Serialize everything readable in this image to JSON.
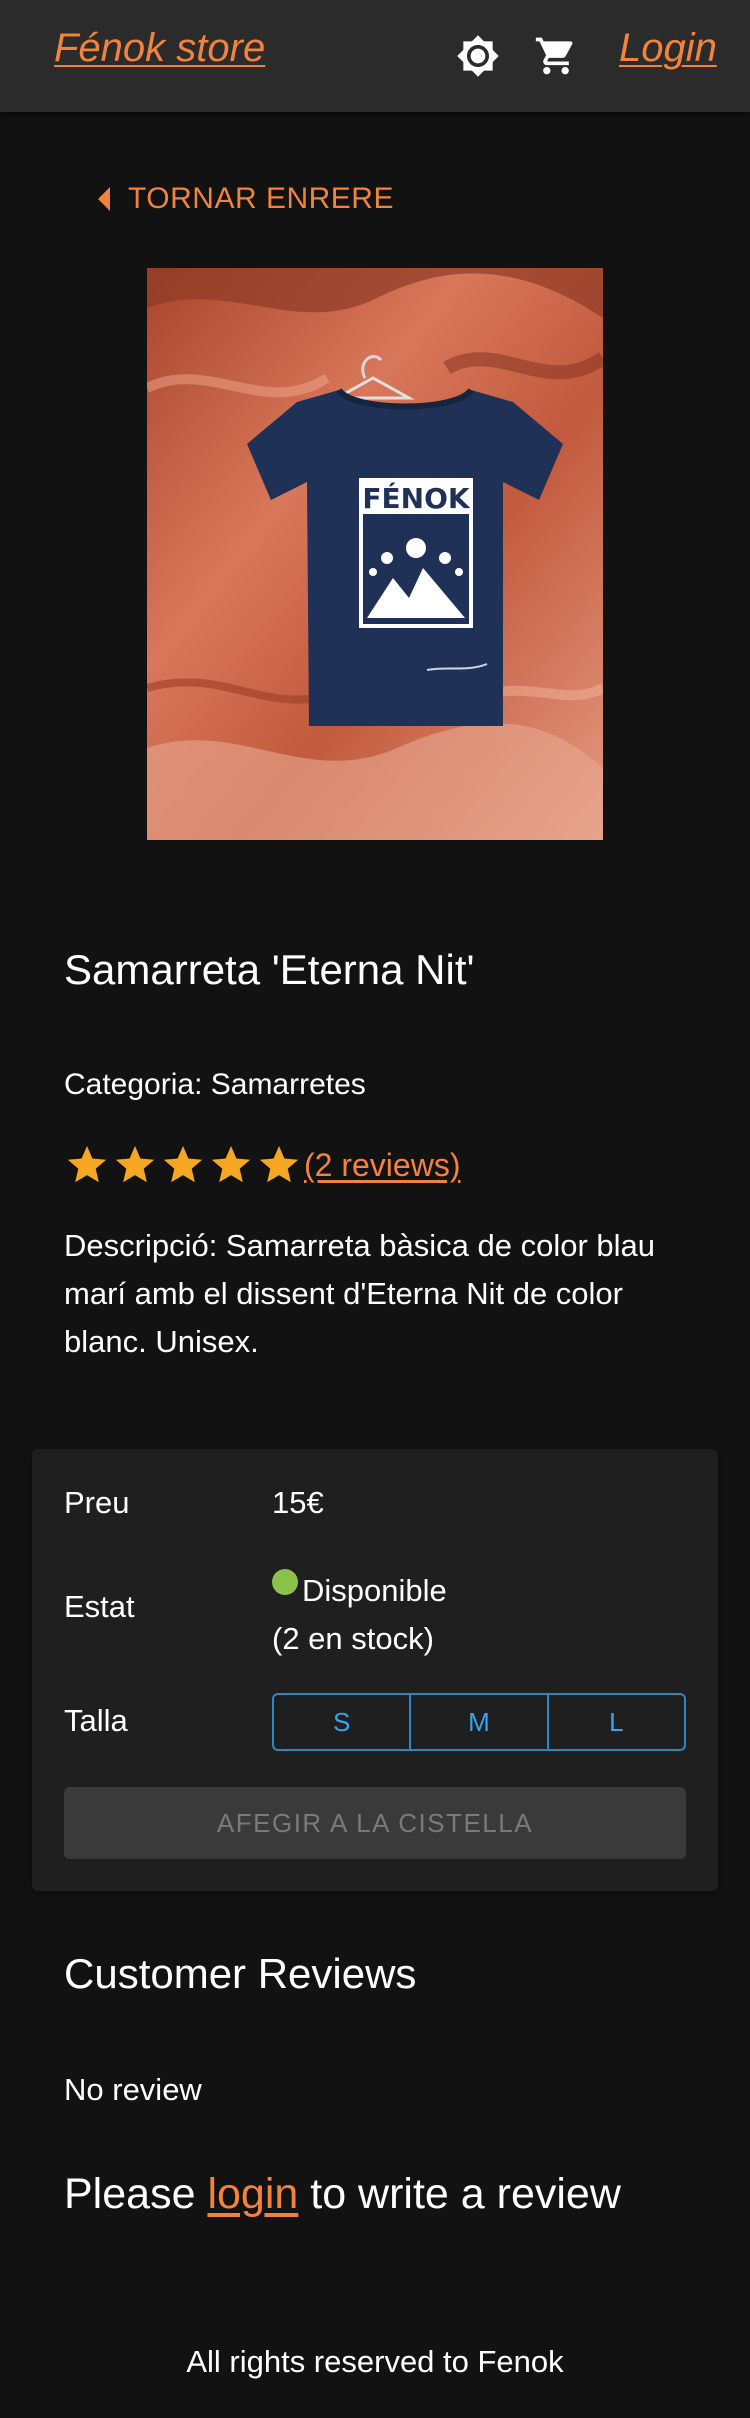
{
  "header": {
    "brand": "Fénok store",
    "theme_icon": "brightness-icon",
    "cart_icon": "cart-icon",
    "login_label": "Login"
  },
  "back": {
    "label": "TORNAR ENRERE",
    "icon": "caret-left-icon"
  },
  "product": {
    "image_print_text": "FÉNOK",
    "title": "Samarreta 'Eterna Nit'",
    "category": "Categoria: Samarretes",
    "rating": 5,
    "rating_max": 5,
    "reviews_link": "(2 reviews)",
    "description": "Descripció: Samarreta bàsica de color blau marí amb el dissent d'Eterna Nit de color blanc. Unisex."
  },
  "purchase": {
    "price_label": "Preu",
    "price_value": "15€",
    "status_label": "Estat",
    "status_value": "Disponible",
    "stock_value": "(2 en stock)",
    "size_label": "Talla",
    "sizes": [
      "S",
      "M",
      "L"
    ],
    "add_button": "AFEGIR A LA CISTELLA"
  },
  "reviews": {
    "title": "Customer Reviews",
    "empty": "No review",
    "prompt_before": "Please ",
    "prompt_link": "login",
    "prompt_after": " to write a review"
  },
  "footer": {
    "text": "All rights reserved to Fenok"
  },
  "colors": {
    "accent": "#f2833d",
    "star": "#f5a623",
    "available": "#8bc34a",
    "size_border": "#2f86c7"
  }
}
